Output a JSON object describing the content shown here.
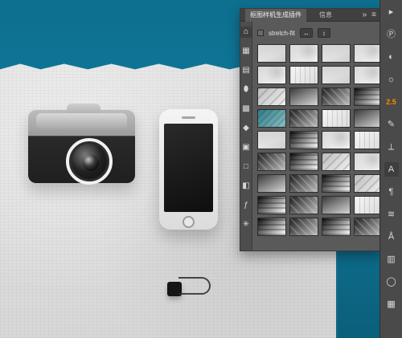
{
  "panel": {
    "tabs": [
      {
        "label": "抠图样机生成插件",
        "active": true
      },
      {
        "label": "信息",
        "active": false
      }
    ],
    "controls": {
      "collapse_label": "»",
      "menu_label": "≡"
    },
    "toolbar": {
      "stretch_fit_label": "stretch-fit"
    },
    "rail_icons": [
      "home-icon",
      "grid-icon",
      "document-icon",
      "drop-icon",
      "checker-icon",
      "shape-icon",
      "layer-icon",
      "square-icon",
      "cube-icon",
      "fx-icon",
      "sparkle-icon"
    ],
    "thumbnails": [
      "v1",
      "v2",
      "v1",
      "v2",
      "v2",
      "v4",
      "v1",
      "v2",
      "v3",
      "v5",
      "v6",
      "v7",
      "teal",
      "v6",
      "v4",
      "v5",
      "v1",
      "v7",
      "v2",
      "v4",
      "v6",
      "v7",
      "v3",
      "v2",
      "v5",
      "v6",
      "v7",
      "v3",
      "v7",
      "v6",
      "v5",
      "v4",
      "v7",
      "v6",
      "v7",
      "v6"
    ]
  },
  "right_toolbar": {
    "badge_text": "2.5",
    "items": [
      "collapse-icon",
      "paragraph-icon",
      "adjust-icon",
      "sun-icon",
      "badge-text",
      "brush-icon",
      "path-icon",
      "text-icon",
      "pilcrow-icon",
      "styles-icon",
      "glyph-icon",
      "layer-comp-icon",
      "circle-icon",
      "swatches-icon"
    ]
  }
}
